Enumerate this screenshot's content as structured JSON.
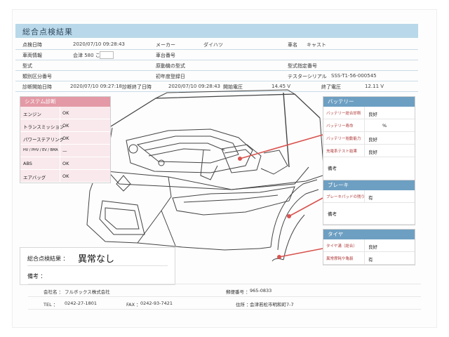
{
  "header": {
    "title": "総合点検結果"
  },
  "info": {
    "inspect_date_label": "点検日時",
    "inspect_date": "2020/07/10 09:28:43",
    "maker_label": "メーカー",
    "maker": "ダイハツ",
    "car_name_label": "車名",
    "car_name": "キャスト",
    "vehicle_info_label": "車両情報",
    "vehicle_info": "会津 580 こ",
    "chassis_label": "車台番号",
    "type_label": "型式",
    "engine_type_label": "原動機の型式",
    "type_designation_label": "型式指定番号",
    "class_label": "類別区分番号",
    "first_reg_label": "初年度登録日",
    "tester_serial_label": "テスターシリアル",
    "tester_serial": "SSS-T1-56-000545",
    "diag_start_label": "診断開始日時",
    "diag_start": "2020/07/10 09:27:18",
    "diag_end_label": "診断終了日時",
    "diag_end": "2020/07/10 09:28:43",
    "start_voltage_label": "開始電圧",
    "start_voltage": "14.45 V",
    "end_voltage_label": "終了電圧",
    "end_voltage": "12.11 V"
  },
  "system": {
    "title": "システム診断",
    "rows": [
      {
        "k": "エンジン",
        "v": "OK"
      },
      {
        "k": "トランスミッション",
        "v": "OK"
      },
      {
        "k": "パワーステアリング",
        "v": "OK"
      },
      {
        "k": "HV / PHV / EV / BMA",
        "v": "—"
      },
      {
        "k": "ABS",
        "v": "OK"
      },
      {
        "k": "エアバッグ",
        "v": "OK"
      }
    ]
  },
  "battery": {
    "title": "バッテリー",
    "rows": [
      {
        "k": "バッテリー総合診断",
        "v": "良好"
      },
      {
        "k": "バッテリー寿命",
        "v": "%"
      },
      {
        "k": "バッテリー始動能力",
        "v": "良好"
      },
      {
        "k": "充電系テスト結果",
        "v": "良好"
      }
    ],
    "notes_label": "備考"
  },
  "brake": {
    "title": "ブレーキ",
    "rows": [
      {
        "k": "ブレーキパッドの残り",
        "v": "有"
      }
    ],
    "notes_label": "備考"
  },
  "tire": {
    "title": "タイヤ",
    "rows": [
      {
        "k": "タイヤ溝（総合）",
        "v": "良好"
      },
      {
        "k": "異常摩耗や亀裂",
        "v": "有"
      }
    ]
  },
  "summary": {
    "label": "総合点検結果 ：",
    "value": "異常なし",
    "notes_label": "備考 ："
  },
  "footer": {
    "company_label": "会社名 ：",
    "company": "フルボックス株式会社",
    "postal_label": "郵便番号 ：",
    "postal": "965-0833",
    "tel_label": "TEL ：",
    "tel": "0242-27-1801",
    "fax_label": "FAX ：",
    "fax": "0242-93-7421",
    "address_label": "住所 ：",
    "address": "会津若松市明和町7-7"
  },
  "colors": {
    "title_bar": "#b9d9ea",
    "system_head": "#e39aa6",
    "panel_head": "#6d9fc2",
    "pointer": "#d9534f"
  }
}
